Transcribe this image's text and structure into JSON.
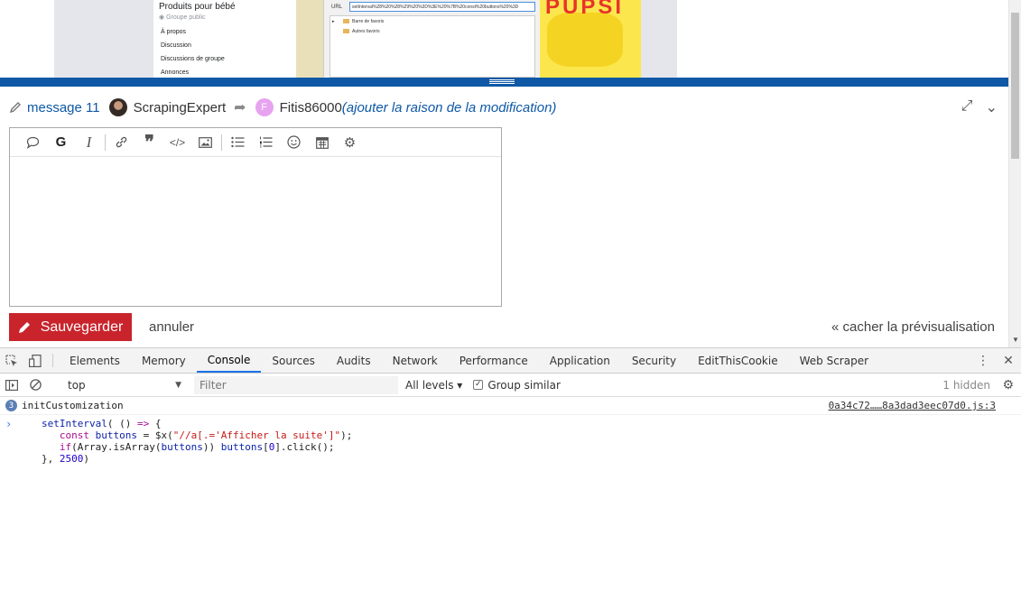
{
  "preview": {
    "group_name": "Produits pour bébé",
    "group_type": "Groupe public",
    "nav": [
      "À propos",
      "Discussion",
      "Discussions de groupe",
      "Annonces"
    ],
    "url_label": "URL",
    "url_value": "setInterval%28%20%28%29%20%3D%3E%20%7B%20const%20buttons%20%3D",
    "tree": [
      "Barre de favoris",
      "Autres favoris"
    ],
    "brand": "PUPSI"
  },
  "composer": {
    "edit_label": "message 11",
    "author": "ScrapingExpert",
    "editor_initial": "F",
    "editor": "Fitis86000",
    "reason": "(ajouter la raison de la modification)",
    "toolbar": {
      "bold": "G",
      "italic": "I"
    },
    "save_label": "Sauvegarder",
    "cancel_label": "annuler",
    "hide_preview_label": "« cacher la prévisualisation"
  },
  "devtools": {
    "tabs": [
      "Elements",
      "Memory",
      "Console",
      "Sources",
      "Audits",
      "Network",
      "Performance",
      "Application",
      "Security",
      "EditThisCookie",
      "Web Scraper"
    ],
    "active_tab": "Console",
    "context": "top",
    "filter_placeholder": "Filter",
    "levels": "All levels ▾",
    "group_similar": "Group similar",
    "hidden": "1 hidden",
    "log": {
      "count": "3",
      "message": "initCustomization",
      "source": "0a34c72……8a3dad3eec07d0.js:3"
    },
    "input_lines": [
      "setInterval( () => {",
      "   const buttons = $x(\"//a[.='Afficher la suite']\");",
      "   if(Array.isArray(buttons)) buttons[0].click();",
      "}, 2500)"
    ]
  }
}
